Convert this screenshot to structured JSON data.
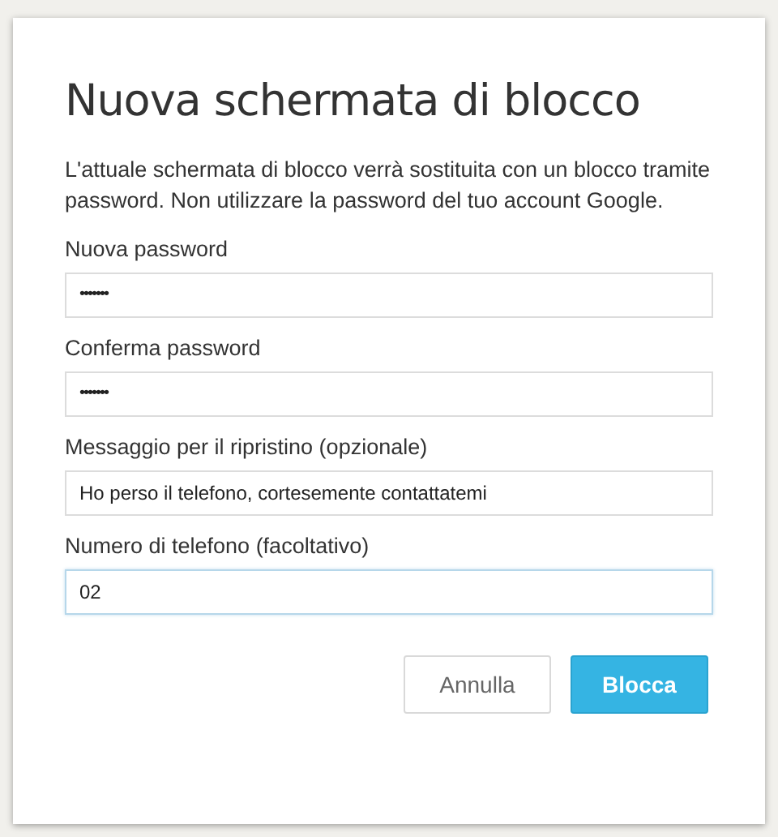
{
  "dialog": {
    "title": "Nuova schermata di blocco",
    "description": "L'attuale schermata di blocco verrà sostituita con un blocco tramite password. Non utilizzare la password del tuo account Google.",
    "fields": [
      {
        "label": "Nuova password",
        "value": "•••••••",
        "kind": "password",
        "focused": false
      },
      {
        "label": "Conferma password",
        "value": "•••••••",
        "kind": "password",
        "focused": false
      },
      {
        "label": "Messaggio per il ripristino (opzionale)",
        "value": "Ho perso il telefono, cortesemente contattatemi",
        "kind": "text",
        "focused": false
      },
      {
        "label": "Numero di telefono (facoltativo)",
        "value": "02",
        "kind": "text",
        "focused": true
      }
    ],
    "buttons": [
      {
        "label": "Annulla",
        "kind": "secondary"
      },
      {
        "label": "Blocca",
        "kind": "primary"
      }
    ]
  }
}
